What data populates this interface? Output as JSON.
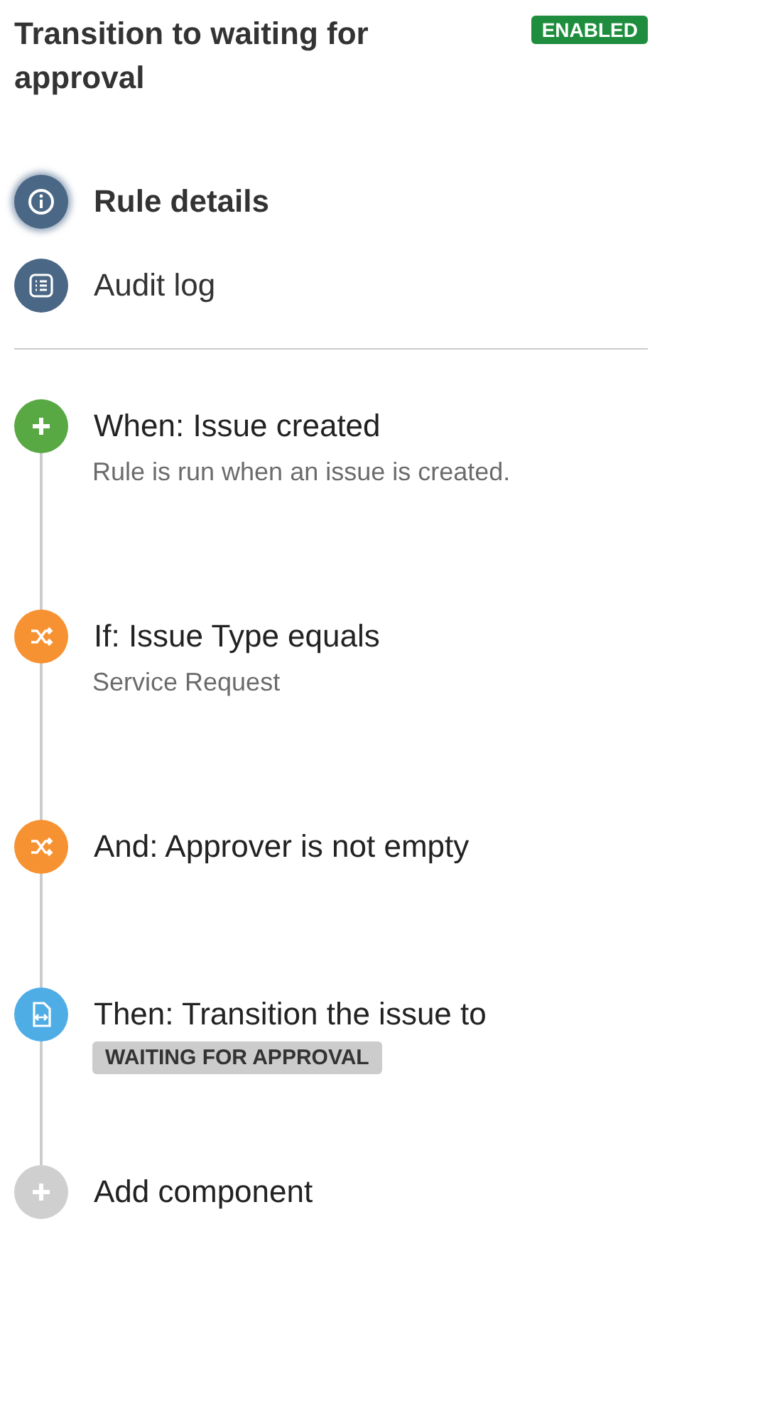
{
  "rule": {
    "title": "Transition to waiting for approval",
    "status": "ENABLED"
  },
  "menu": [
    {
      "label": "Rule details",
      "kind": "info",
      "selected": true
    },
    {
      "label": "Audit log",
      "kind": "list",
      "selected": false
    }
  ],
  "steps": [
    {
      "kind": "trigger",
      "title": "When: Issue created",
      "detail": {
        "kind": "text",
        "text": "Rule is run when an issue is created."
      }
    },
    {
      "kind": "condition",
      "title": "If: Issue Type equals",
      "detail": {
        "kind": "text",
        "text": "Service Request"
      }
    },
    {
      "kind": "condition",
      "title": "And: Approver is not empty"
    },
    {
      "kind": "action",
      "title": "Then: Transition the issue to",
      "detail": {
        "kind": "lozenge",
        "text": "WAITING FOR APPROVAL"
      }
    },
    {
      "kind": "add",
      "title": "Add component"
    }
  ]
}
